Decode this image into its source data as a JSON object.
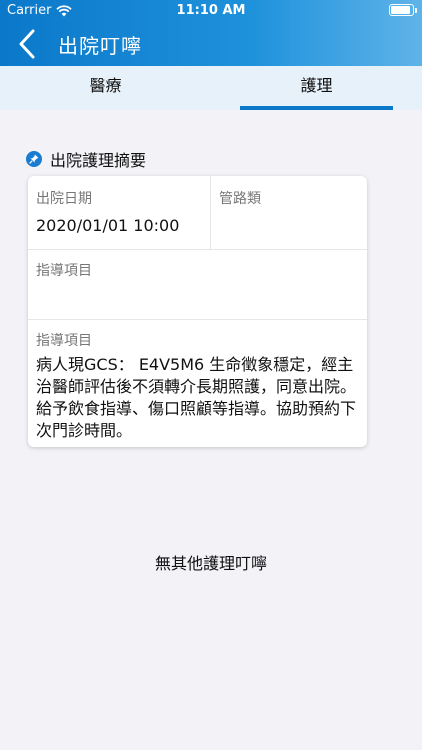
{
  "status_bar": {
    "carrier": "Carrier",
    "time": "11:10 AM"
  },
  "nav": {
    "title": "出院叮嚀"
  },
  "tabs": [
    {
      "label": "醫療",
      "active": false
    },
    {
      "label": "護理",
      "active": true
    }
  ],
  "section": {
    "title": "出院護理摘要"
  },
  "card": {
    "discharge_date_label": "出院日期",
    "discharge_date_value": "2020/01/01 10:00",
    "catheter_label": "管路類",
    "catheter_value": "",
    "guidance_label_1": "指導項目",
    "guidance_value_1": "",
    "guidance_label_2": "指導項目",
    "guidance_value_2": "病人現GCS： E4V5M6 生命徵象穩定，經主治醫師評估後不須轉介長期照護，同意出院。給予飲食指導、傷口照顧等指導。協助預約下次門診時間。"
  },
  "empty_message": "無其他護理叮嚀",
  "colors": {
    "primary": "#0b78c9",
    "tab_bg": "#e7f1fa",
    "page_bg": "#f2f2f7"
  }
}
